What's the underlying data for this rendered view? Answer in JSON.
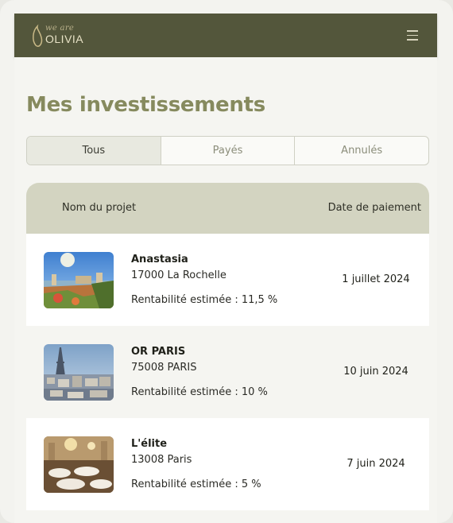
{
  "header": {
    "logo_top": "we are",
    "logo_main": "OLIVIA",
    "menu_icon": "hamburger-menu-icon"
  },
  "page": {
    "title": "Mes investissements"
  },
  "tabs": [
    {
      "label": "Tous",
      "active": true
    },
    {
      "label": "Payés",
      "active": false
    },
    {
      "label": "Annulés",
      "active": false
    }
  ],
  "table": {
    "columns": [
      "Nom du projet",
      "Date de paiement"
    ],
    "rows": [
      {
        "name": "Anastasia",
        "address": "17000 La Rochelle",
        "rentability": "Rentabilité estimée : 11,5 %",
        "date": "1 juillet 2024",
        "image": "la-rochelle-harbor-photo"
      },
      {
        "name": "OR PARIS",
        "address": "75008 PARIS",
        "rentability": "Rentabilité estimée : 10 %",
        "date": "10 juin 2024",
        "image": "paris-eiffel-tower-photo"
      },
      {
        "name": "L'élite",
        "address": "13008 Paris",
        "rentability": "Rentabilité estimée : 5 %",
        "date": "7 juin 2024",
        "image": "restaurant-interior-photo"
      }
    ]
  },
  "colors": {
    "header_bg": "#53563b",
    "title": "#868a5e",
    "table_head_bg": "#d3d4c1"
  }
}
